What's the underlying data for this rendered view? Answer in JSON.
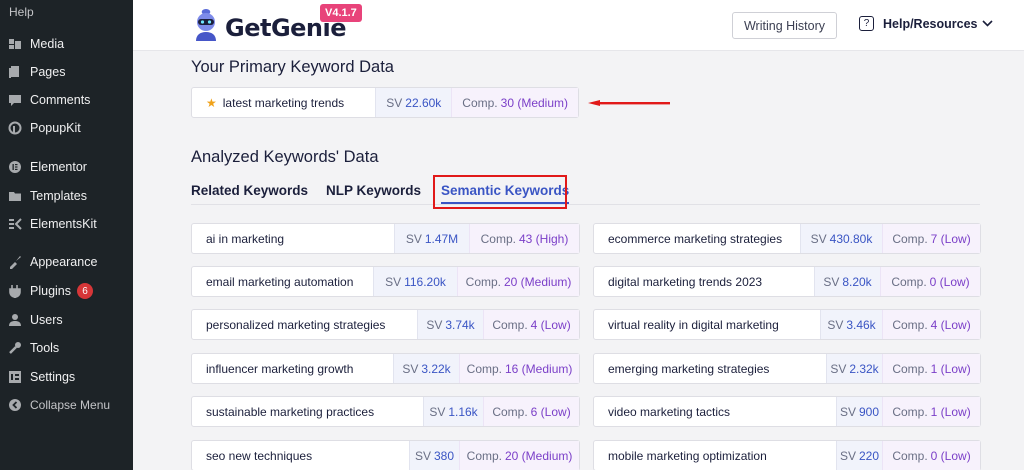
{
  "sidebar": {
    "help_label": "Help",
    "items": [
      {
        "label": "Media",
        "icon": "media-icon"
      },
      {
        "label": "Pages",
        "icon": "pages-icon"
      },
      {
        "label": "Comments",
        "icon": "comments-icon"
      },
      {
        "label": "PopupKit",
        "icon": "popupkit-icon"
      },
      {
        "label": "Elementor",
        "icon": "elementor-icon"
      },
      {
        "label": "Templates",
        "icon": "templates-icon"
      },
      {
        "label": "ElementsKit",
        "icon": "elementskit-icon"
      },
      {
        "label": "Appearance",
        "icon": "appearance-icon"
      },
      {
        "label": "Plugins",
        "icon": "plugins-icon",
        "badge": "6"
      },
      {
        "label": "Users",
        "icon": "users-icon"
      },
      {
        "label": "Tools",
        "icon": "tools-icon"
      },
      {
        "label": "Settings",
        "icon": "settings-icon"
      },
      {
        "label": "Collapse Menu",
        "icon": "collapse-icon"
      }
    ]
  },
  "header": {
    "logo_text": "GetGenie",
    "version": "V4.1.7",
    "writing_history": "Writing History",
    "help_resources": "Help/Resources"
  },
  "primary": {
    "heading": "Your Primary Keyword Data",
    "keyword": "latest marketing trends",
    "sv_label": "SV",
    "sv": "22.60k",
    "comp_label": "Comp.",
    "comp": "30 (Medium)"
  },
  "analyzed": {
    "heading": "Analyzed Keywords' Data",
    "tabs": [
      "Related Keywords",
      "NLP Keywords",
      "Semantic Keywords"
    ],
    "active_tab": 2,
    "left": [
      {
        "keyword": "ai in marketing",
        "sv": "1.47M",
        "comp": "43 (High)"
      },
      {
        "keyword": "email marketing automation",
        "sv": "116.20k",
        "comp": "20 (Medium)"
      },
      {
        "keyword": "personalized marketing strategies",
        "sv": "3.74k",
        "comp": "4 (Low)"
      },
      {
        "keyword": "influencer marketing growth",
        "sv": "3.22k",
        "comp": "16 (Medium)"
      },
      {
        "keyword": "sustainable marketing practices",
        "sv": "1.16k",
        "comp": "6 (Low)"
      },
      {
        "keyword": "seo new techniques",
        "sv": "380",
        "comp": "20 (Medium)"
      }
    ],
    "right": [
      {
        "keyword": "ecommerce marketing strategies",
        "sv": "430.80k",
        "comp": "7 (Low)"
      },
      {
        "keyword": "digital marketing trends 2023",
        "sv": "8.20k",
        "comp": "0 (Low)"
      },
      {
        "keyword": "virtual reality in digital marketing",
        "sv": "3.46k",
        "comp": "4 (Low)"
      },
      {
        "keyword": "emerging marketing strategies",
        "sv": "2.32k",
        "comp": "1 (Low)"
      },
      {
        "keyword": "video marketing tactics",
        "sv": "900",
        "comp": "1 (Low)"
      },
      {
        "keyword": "mobile marketing optimization",
        "sv": "220",
        "comp": "0 (Low)"
      }
    ]
  },
  "colors": {
    "sidebar_bg": "#1d2327",
    "accent_blue": "#3a55c4",
    "comp_purple": "#7b3fc8",
    "highlight_red": "#e11919",
    "version_pink": "#e8437a"
  }
}
